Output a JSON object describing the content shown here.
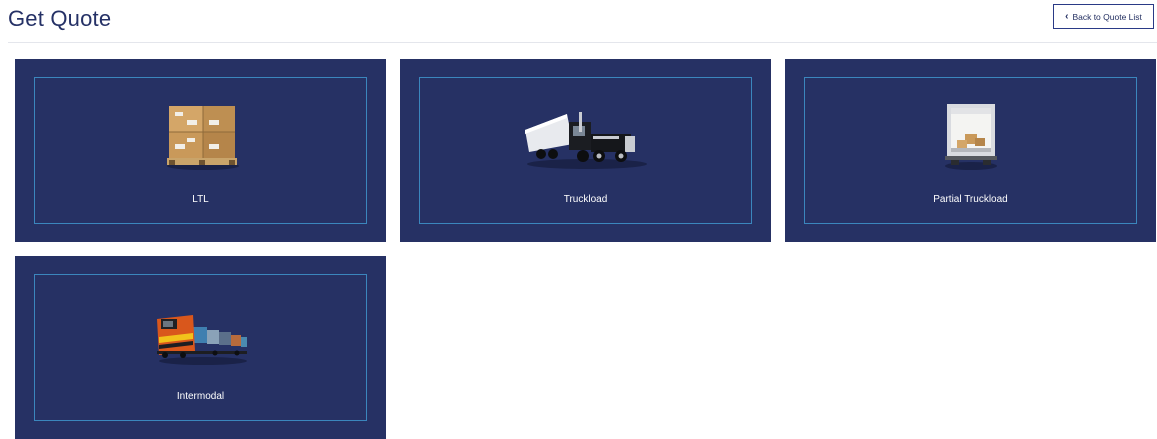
{
  "header": {
    "title": "Get Quote",
    "back_label": "Back to Quote List",
    "back_icon": "chevron-left-icon"
  },
  "quote_types": [
    {
      "label": "LTL",
      "icon": "pallet-boxes-icon"
    },
    {
      "label": "Truckload",
      "icon": "semi-truck-icon"
    },
    {
      "label": "Partial Truckload",
      "icon": "open-trailer-icon"
    },
    {
      "label": "Intermodal",
      "icon": "train-icon"
    }
  ],
  "colors": {
    "title": "#253166",
    "card_background": "#263164",
    "card_inner_border": "#3b86bd",
    "button_border": "#2a3a86"
  }
}
